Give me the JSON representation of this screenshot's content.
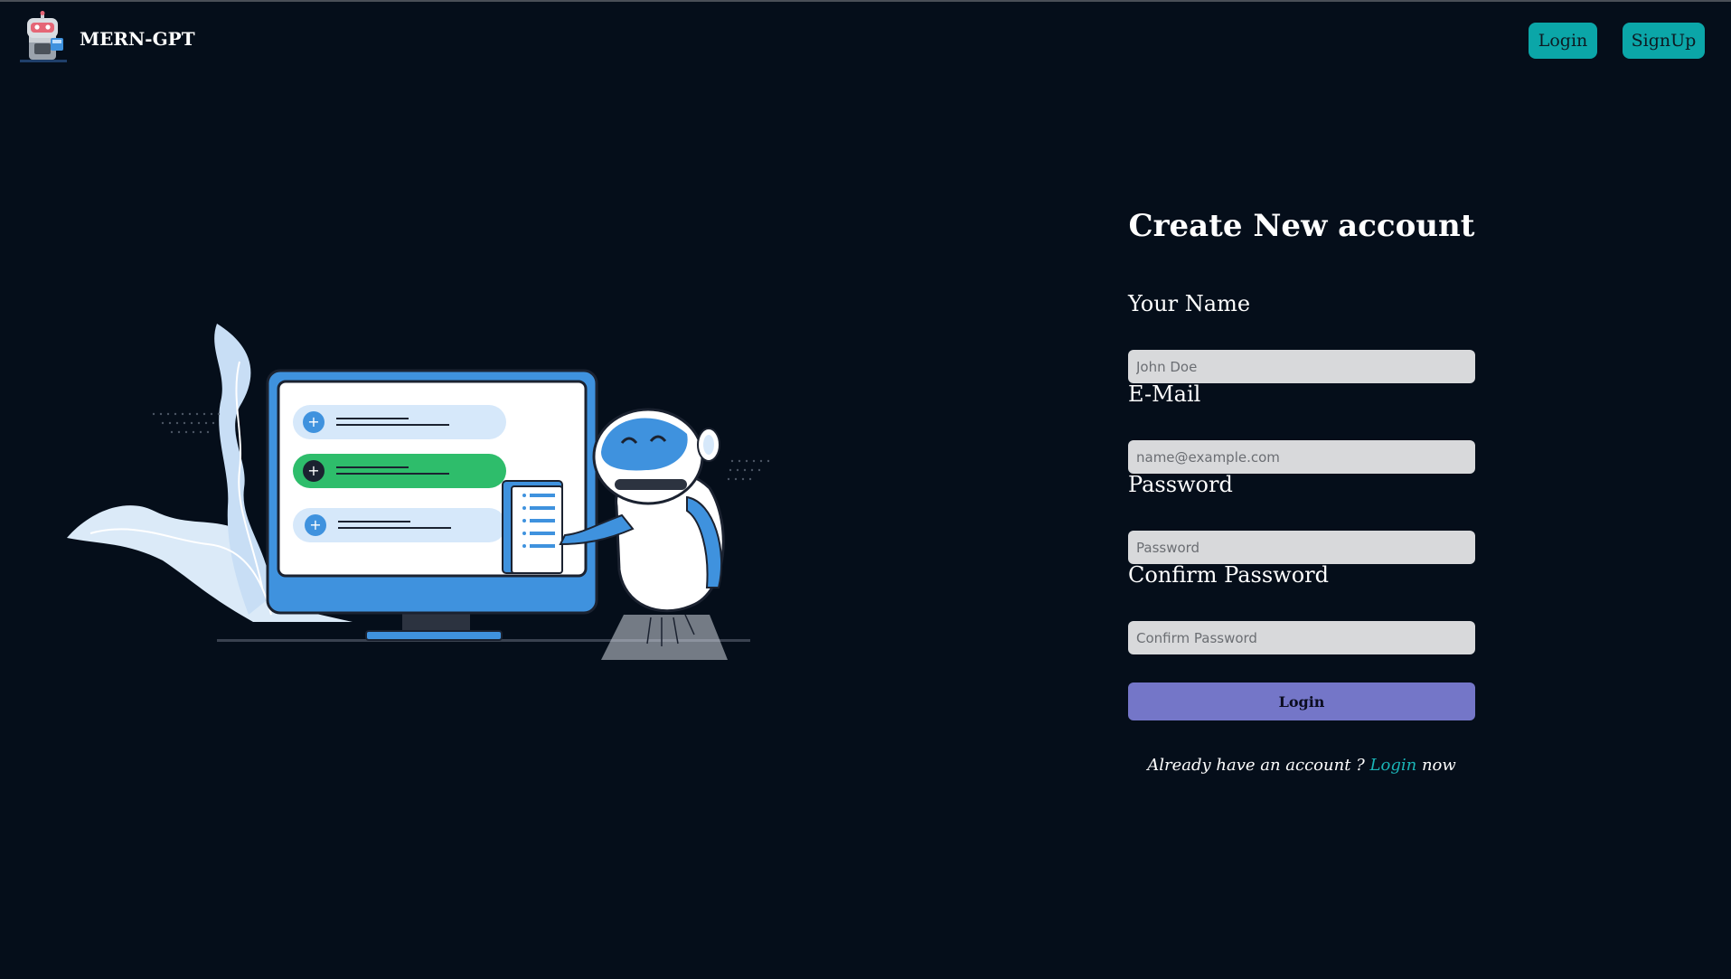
{
  "app": {
    "name": "MERN-GPT"
  },
  "header": {
    "login_label": "Login",
    "signup_label": "SignUp"
  },
  "form": {
    "title": "Create New account",
    "fields": [
      {
        "label": "Your Name",
        "placeholder": "John Doe",
        "value": ""
      },
      {
        "label": "E-Mail",
        "placeholder": "name@example.com",
        "value": ""
      },
      {
        "label": "Password",
        "placeholder": "Password",
        "value": ""
      },
      {
        "label": "Confirm Password",
        "placeholder": "Confirm Password",
        "value": ""
      }
    ],
    "submit_label": "Login",
    "footer_prefix": "Already have an account ? ",
    "footer_link": "Login",
    "footer_suffix": " now"
  },
  "illustration": {
    "icon": "robot-computer-illustration"
  },
  "colors": {
    "background": "#050e1a",
    "accent": "#0ba6a8",
    "submit": "#7476c8",
    "input_bg": "#d8d9db",
    "link": "#1ab3b6",
    "green": "#2ebd6b",
    "blue": "#3f92de"
  }
}
